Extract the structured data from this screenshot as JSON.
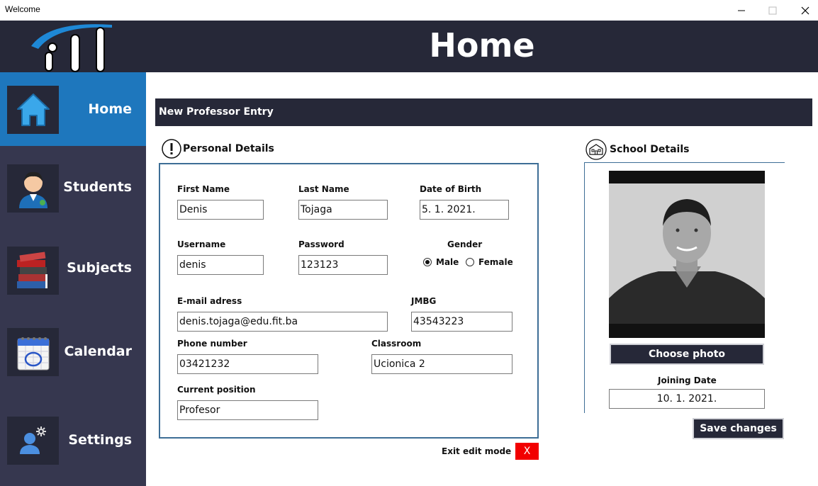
{
  "window": {
    "title": "Welcome"
  },
  "header": {
    "title": "Home"
  },
  "sidebar": {
    "items": [
      {
        "label": "Home",
        "icon": "home-icon",
        "active": true
      },
      {
        "label": "Students",
        "icon": "student-avatar-icon",
        "active": false
      },
      {
        "label": "Subjects",
        "icon": "books-icon",
        "active": false
      },
      {
        "label": "Calendar",
        "icon": "calendar-icon",
        "active": false
      },
      {
        "label": "Settings",
        "icon": "user-settings-icon",
        "active": false
      }
    ]
  },
  "main": {
    "section_title": "New Professor Entry",
    "personal": {
      "title": "Personal Details",
      "first_name": {
        "label": "First Name",
        "value": "Denis"
      },
      "last_name": {
        "label": "Last Name",
        "value": "Tojaga"
      },
      "dob": {
        "label": "Date of Birth",
        "value": "5. 1. 2021."
      },
      "username": {
        "label": "Username",
        "value": "denis"
      },
      "password": {
        "label": "Password",
        "value": "123123"
      },
      "gender": {
        "label": "Gender",
        "options": [
          "Male",
          "Female"
        ],
        "selected": "Male"
      },
      "email": {
        "label": "E-mail adress",
        "value": "denis.tojaga@edu.fit.ba"
      },
      "jmbg": {
        "label": "JMBG",
        "value": "43543223"
      },
      "phone": {
        "label": "Phone number",
        "value": "03421232"
      },
      "classroom": {
        "label": "Classroom",
        "value": "Ucionica 2"
      },
      "position": {
        "label": "Current position",
        "value": "Profesor"
      }
    },
    "school": {
      "title": "School Details",
      "choose_photo": "Choose photo",
      "joining_date": {
        "label": "Joining Date",
        "value": "10. 1. 2021."
      },
      "save": "Save changes"
    },
    "exit_edit": {
      "label": "Exit edit mode",
      "button": "X"
    }
  },
  "colors": {
    "header_bg": "#262838",
    "sidebar_bg": "#36374f",
    "active_nav": "#1e77bd",
    "border_accent": "#3d6e96",
    "exit_button": "#f20000"
  }
}
